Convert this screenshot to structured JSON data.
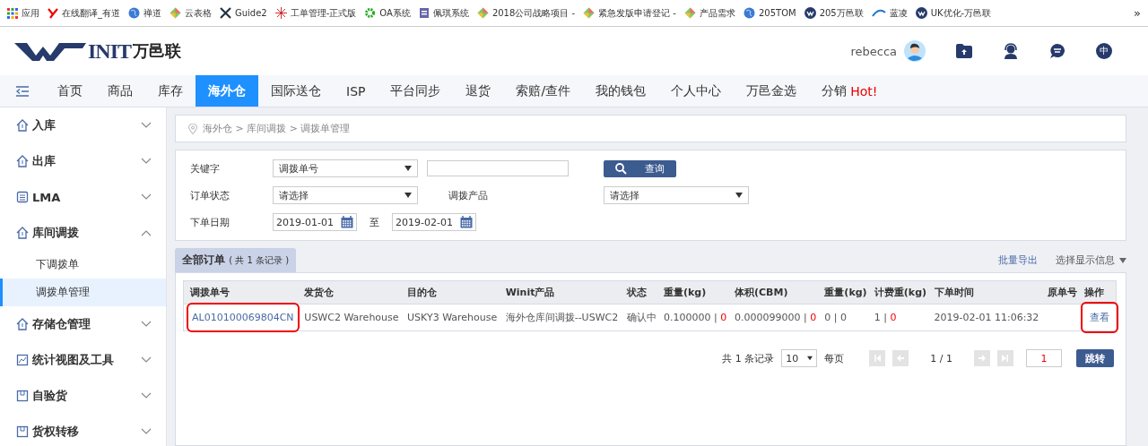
{
  "bookmarks": [
    {
      "label": "应用",
      "kind": "grid"
    },
    {
      "label": "在线翻译_有道",
      "kind": "y"
    },
    {
      "label": "禅道",
      "kind": "globe"
    },
    {
      "label": "云表格",
      "kind": "diamond"
    },
    {
      "label": "Guide2",
      "kind": "x"
    },
    {
      "label": "工单管理-正式版",
      "kind": "star"
    },
    {
      "label": "OA系统",
      "kind": "gear"
    },
    {
      "label": "佩琪系统",
      "kind": "doc"
    },
    {
      "label": "2018公司战略项目 -",
      "kind": "diamond"
    },
    {
      "label": "紧急发版申请登记 -",
      "kind": "diamond"
    },
    {
      "label": "产品需求",
      "kind": "diamond"
    },
    {
      "label": "205TOM",
      "kind": "globe"
    },
    {
      "label": "205万邑联",
      "kind": "w"
    },
    {
      "label": "蓝凌",
      "kind": "ekp"
    },
    {
      "label": "UK优化-万邑联",
      "kind": "w"
    }
  ],
  "bookmarks_more": "»",
  "logo": {
    "mark": "INIT",
    "name": "万邑联"
  },
  "user": {
    "name": "rebecca"
  },
  "header_icons": [
    {
      "kind": "folder"
    },
    {
      "kind": "support"
    },
    {
      "kind": "chat"
    },
    {
      "kind": "lang",
      "label": "中"
    }
  ],
  "nav": [
    {
      "label": "首页",
      "selected": false
    },
    {
      "label": "商品",
      "selected": false
    },
    {
      "label": "库存",
      "selected": false
    },
    {
      "label": "海外仓",
      "selected": true
    },
    {
      "label": "国际送仓",
      "selected": false
    },
    {
      "label": "ISP",
      "selected": false
    },
    {
      "label": "平台同步",
      "selected": false
    },
    {
      "label": "退货",
      "selected": false
    },
    {
      "label": "索赔/查件",
      "selected": false
    },
    {
      "label": "我的钱包",
      "selected": false
    },
    {
      "label": "个人中心",
      "selected": false
    },
    {
      "label": "万邑金选",
      "selected": false
    },
    {
      "label": "分销",
      "badge": "Hot!",
      "selected": false
    }
  ],
  "sidebar": [
    {
      "label": "入库",
      "kind": "house",
      "expanded": false
    },
    {
      "label": "出库",
      "kind": "house",
      "expanded": false
    },
    {
      "label": "LMA",
      "kind": "list",
      "expanded": false
    },
    {
      "label": "库间调拨",
      "kind": "house",
      "expanded": true,
      "children": [
        {
          "label": "下调拨单",
          "selected": false
        },
        {
          "label": "调拨单管理",
          "selected": true
        }
      ]
    },
    {
      "label": "存储仓管理",
      "kind": "house",
      "expanded": false
    },
    {
      "label": "统计视图及工具",
      "kind": "chart",
      "expanded": false
    },
    {
      "label": "自验货",
      "kind": "box",
      "expanded": false
    },
    {
      "label": "货权转移",
      "kind": "box",
      "expanded": false
    }
  ],
  "breadcrumb": [
    "海外仓",
    "库间调拨",
    "调拨单管理"
  ],
  "breadcrumb_sep": ">",
  "filters": {
    "keyword_label": "关键字",
    "keyword_type": "调拨单号",
    "search_button": "查询",
    "status_label": "订单状态",
    "status_value": "请选择",
    "product_label": "调拨产品",
    "product_value": "请选择",
    "date_label": "下单日期",
    "date_from": "2019-01-01",
    "date_sep": "至",
    "date_to": "2019-02-01"
  },
  "tab": {
    "label": "全部订单",
    "count": "( 共 1 条记录 )"
  },
  "actions": {
    "export": "批量导出",
    "display": "选择显示信息"
  },
  "table": {
    "columns": [
      "调拨单号",
      "发货仓",
      "目的仓",
      "Winit产品",
      "状态",
      "重量(kg)",
      "体积(CBM)",
      "重量(kg)",
      "计费重(kg)",
      "下单时间",
      "原单号",
      "操作"
    ],
    "rows": [
      {
        "order_no": {
          "text": "AL010100069804CN",
          "annotated": true
        },
        "from": "USWC2 Warehouse",
        "to": "USKY3 Warehouse",
        "product": "海外仓库间调拨--USWC2",
        "status": "确认中",
        "weight": {
          "value": "0.100000",
          "sep": "|",
          "extra": "0",
          "highlight": true
        },
        "volume": {
          "value": "0.000099000",
          "sep": "|",
          "extra": "0",
          "highlight": true
        },
        "weight2": {
          "value": "0",
          "sep": "|",
          "extra": "0",
          "highlight": false
        },
        "charge": {
          "value": "1",
          "sep": "|",
          "extra": "0",
          "highlight": true
        },
        "time": "2019-02-01 11:06:32",
        "action": {
          "text": "查看",
          "annotated": true
        }
      }
    ]
  },
  "pagination": {
    "total": "共 1 条记录",
    "page_size": "10",
    "per_page": "每页",
    "page": "1 / 1",
    "goto": "1",
    "jump": "跳转"
  }
}
